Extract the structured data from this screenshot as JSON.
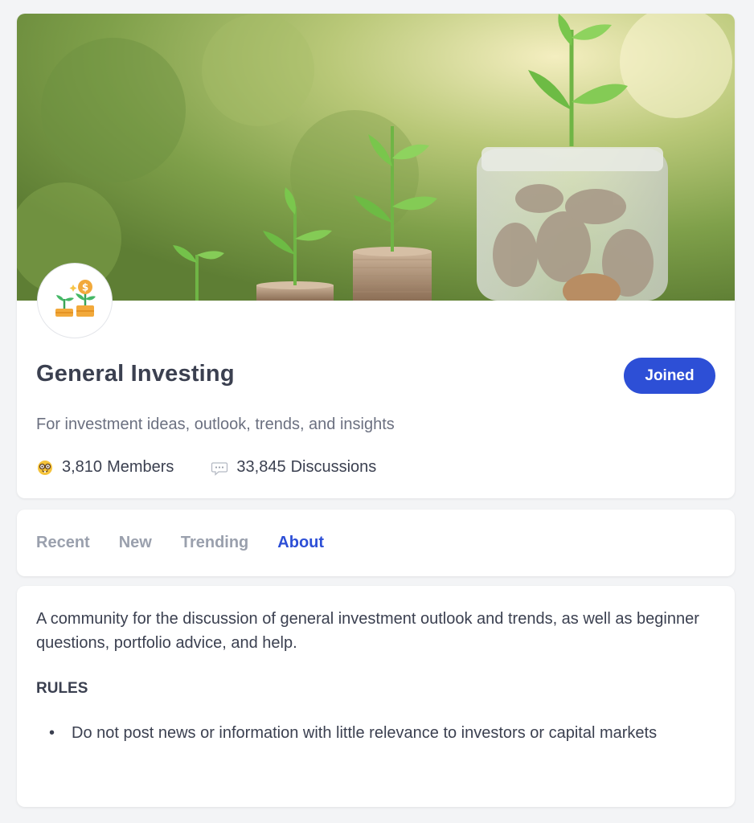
{
  "community": {
    "name": "General Investing",
    "description": "For investment ideas, outlook, trends, and insights",
    "join_label": "Joined",
    "banner_icon": "plant-coins-banner",
    "avatar_icon": "money-plant-icon"
  },
  "stats": {
    "members": {
      "icon": "nerd-face-emoji",
      "count": "3,810",
      "label": "Members"
    },
    "discussions": {
      "icon": "speech-bubble-emoji",
      "count": "33,845",
      "label": "Discussions"
    }
  },
  "tabs": [
    {
      "label": "Recent",
      "active": false
    },
    {
      "label": "New",
      "active": false
    },
    {
      "label": "Trending",
      "active": false
    },
    {
      "label": "About",
      "active": true
    }
  ],
  "about": {
    "text": "A community for the discussion of general investment outlook and trends, as well as beginner questions, portfolio advice, and help.",
    "rules_heading": "RULES",
    "rules": [
      "Do not post news or information with little relevance to investors or capital markets"
    ]
  },
  "colors": {
    "accent": "#2d4fd6",
    "page_background": "#f3f4f6",
    "muted_tab": "#9aa0ad"
  }
}
